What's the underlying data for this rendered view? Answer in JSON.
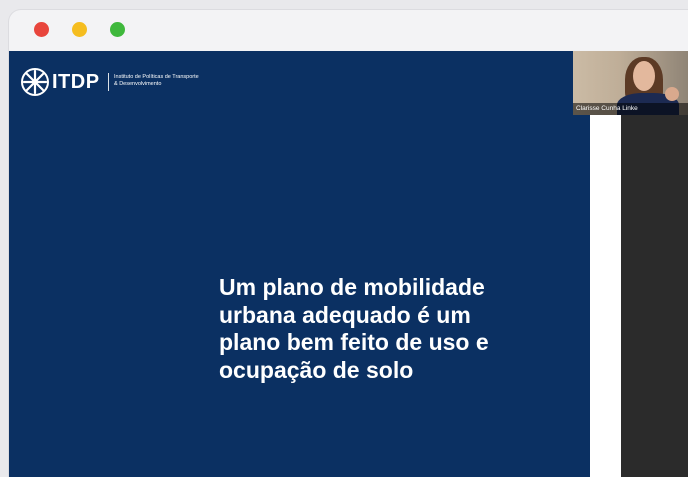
{
  "window": {
    "controls": [
      "close",
      "minimize",
      "maximize"
    ]
  },
  "slide": {
    "logo": {
      "brand": "ITDP",
      "subtitle_line1": "Instituto de Políticas de Transporte",
      "subtitle_line2": "& Desenvolvimento",
      "icon": "itdp-wheel-icon"
    },
    "headline": [
      "Um plano de mobilidade",
      "urbana adequado é um",
      "plano bem feito de uso e",
      "ocupação de solo"
    ],
    "background_color": "#0b3062"
  },
  "participant": {
    "name": "Clarisse Cunha Linke"
  },
  "colors": {
    "close": "#e8453c",
    "minimize": "#f5bd1f",
    "maximize": "#3fb83c"
  }
}
